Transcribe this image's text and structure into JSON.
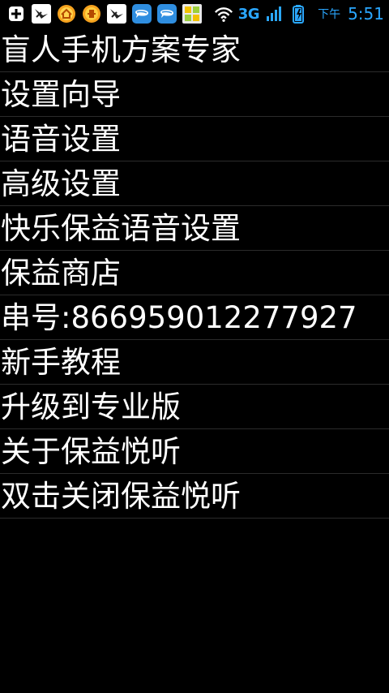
{
  "status_bar": {
    "network": "3G",
    "time_prefix": "下午",
    "time": "5:51",
    "accent_color": "#2aa7ff",
    "left_icons": [
      "add-icon",
      "bird-app-icon",
      "home-app-icon",
      "coin-app-icon",
      "bird-app-icon",
      "chat-app-icon",
      "chat-app-icon",
      "grid-app-icon"
    ],
    "right_icons": [
      "wifi-icon",
      "signal-icon",
      "battery-charging-icon"
    ]
  },
  "menu": {
    "items": [
      {
        "label": "盲人手机方案专家"
      },
      {
        "label": "设置向导"
      },
      {
        "label": "语音设置"
      },
      {
        "label": "高级设置"
      },
      {
        "label": "快乐保益语音设置"
      },
      {
        "label": "保益商店"
      },
      {
        "label": "串号:866959012277927"
      },
      {
        "label": "新手教程"
      },
      {
        "label": "升级到专业版"
      },
      {
        "label": "关于保益悦听"
      },
      {
        "label": "双击关闭保益悦听"
      }
    ]
  }
}
